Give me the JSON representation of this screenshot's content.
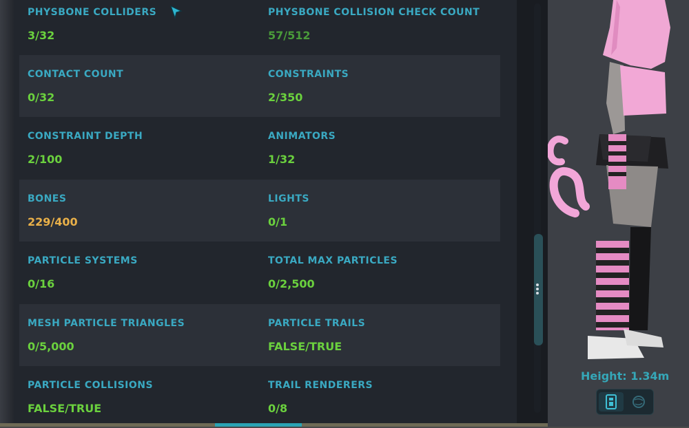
{
  "stats": [
    {
      "left": {
        "label": "PHYSBONE COLLIDERS",
        "value": "3/32"
      },
      "right": {
        "label": "PHYSBONE COLLISION CHECK COUNT",
        "value": "57/512"
      }
    },
    {
      "left": {
        "label": "CONTACT COUNT",
        "value": "0/32"
      },
      "right": {
        "label": "CONSTRAINTS",
        "value": "2/350"
      }
    },
    {
      "left": {
        "label": "CONSTRAINT DEPTH",
        "value": "2/100"
      },
      "right": {
        "label": "ANIMATORS",
        "value": "1/32"
      }
    },
    {
      "left": {
        "label": "BONES",
        "value": "229/400"
      },
      "right": {
        "label": "LIGHTS",
        "value": "0/1"
      }
    },
    {
      "left": {
        "label": "PARTICLE SYSTEMS",
        "value": "0/16"
      },
      "right": {
        "label": "TOTAL MAX PARTICLES",
        "value": "0/2,500"
      }
    },
    {
      "left": {
        "label": "MESH PARTICLE TRIANGLES",
        "value": "0/5,000"
      },
      "right": {
        "label": "PARTICLE TRAILS",
        "value": "FALSE/TRUE"
      }
    },
    {
      "left": {
        "label": "PARTICLE COLLISIONS",
        "value": "FALSE/TRUE"
      },
      "right": {
        "label": "TRAIL RENDERERS",
        "value": "0/8"
      }
    }
  ],
  "avatar_preview": {
    "height_label": "Height: 1.34m",
    "view_buttons": [
      "body-view-icon",
      "globe-view-icon"
    ]
  },
  "colors": {
    "label": "#3aa9c2",
    "value_ok": "#6bd13e",
    "value_warning": "#e9b049",
    "panel_bg": "#22262d",
    "accent": "#2aa3b3"
  }
}
